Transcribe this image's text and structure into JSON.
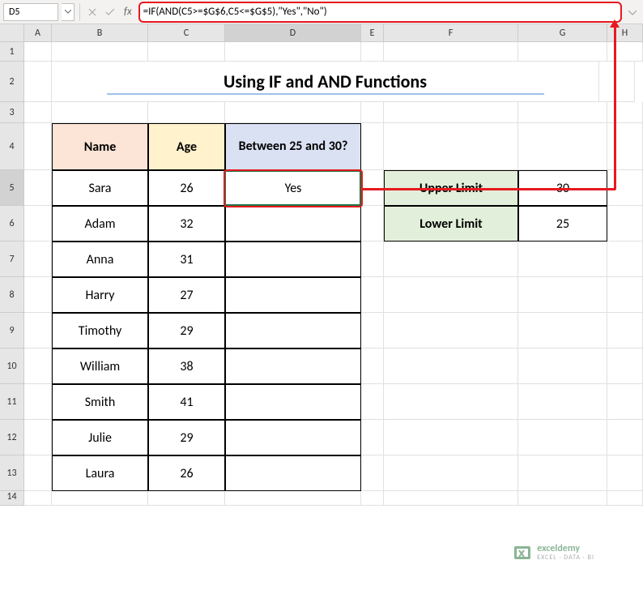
{
  "name_box": "D5",
  "formula": "=IF(AND(C5>=$G$6,C5<=$G$5),\"Yes\",\"No\")",
  "columns": [
    "A",
    "B",
    "C",
    "D",
    "E",
    "F",
    "G",
    "H"
  ],
  "selected_col": "D",
  "selected_row": 5,
  "title": "Using IF and AND Functions",
  "headers": {
    "name": "Name",
    "age": "Age",
    "between": "Between 25 and 30?"
  },
  "data_rows": [
    {
      "name": "Sara",
      "age": 26,
      "between": "Yes"
    },
    {
      "name": "Adam",
      "age": 32,
      "between": ""
    },
    {
      "name": "Anna",
      "age": 31,
      "between": ""
    },
    {
      "name": "Harry",
      "age": 27,
      "between": ""
    },
    {
      "name": "Timothy",
      "age": 29,
      "between": ""
    },
    {
      "name": "William",
      "age": 38,
      "between": ""
    },
    {
      "name": "Smith",
      "age": 41,
      "between": ""
    },
    {
      "name": "Julie",
      "age": 29,
      "between": ""
    },
    {
      "name": "Laura",
      "age": 26,
      "between": ""
    }
  ],
  "limits": {
    "upper_label": "Upper Limit",
    "upper_value": 30,
    "lower_label": "Lower Limit",
    "lower_value": 25
  },
  "watermark": {
    "brand": "exceldemy",
    "tagline": "EXCEL · DATA · BI"
  }
}
